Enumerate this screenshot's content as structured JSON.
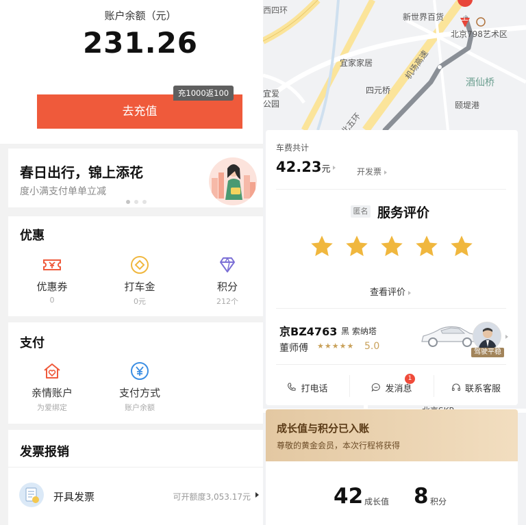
{
  "wallet": {
    "balance_label": "账户余额（元）",
    "balance": "231.26",
    "recharge_label": "去充值",
    "promo_tag": "充1000返100"
  },
  "banner": {
    "title": "春日出行，锦上添花",
    "subtitle": "度小满支付单单立减",
    "carousel_pages": 3,
    "carousel_active": 1
  },
  "discounts": {
    "title": "优惠",
    "items": [
      {
        "label": "优惠券",
        "sub": "0",
        "icon": "ticket-icon"
      },
      {
        "label": "打车金",
        "sub": "0元",
        "icon": "coin-icon"
      },
      {
        "label": "积分",
        "sub": "212个",
        "icon": "diamond-icon"
      }
    ]
  },
  "payment": {
    "title": "支付",
    "items": [
      {
        "label": "亲情账户",
        "sub": "为爱绑定",
        "icon": "family-house-icon"
      },
      {
        "label": "支付方式",
        "sub": "账户余额",
        "icon": "yen-icon"
      }
    ]
  },
  "invoice": {
    "title": "发票报销",
    "row_label": "开具发票",
    "quota": "可开额度3,053.17元"
  },
  "map": {
    "labels": [
      "西四环",
      "新世界百货",
      "北京798艺术区",
      "宜家家居",
      "机场高速",
      "酒仙桥",
      "四元桥",
      "颐堤港",
      "宜爱",
      "公园",
      "北五环",
      "北京SKP",
      "上"
    ]
  },
  "trip": {
    "fare_label": "车费共计",
    "fare": "42.23",
    "fare_unit": "元",
    "invoice_link": "开发票",
    "anon_tag": "匿名",
    "rating_title": "服务评价",
    "stars": 5,
    "view_rating": "查看评价",
    "plate": "京BZ4763",
    "car_desc": "黑  索纳塔",
    "driver_name": "董师傅",
    "driver_stars": "★★★★★",
    "driver_score": "5.0",
    "driver_badge": "驾驶平稳",
    "actions": [
      {
        "label": "打电话",
        "icon": "phone-icon"
      },
      {
        "label": "发消息",
        "icon": "message-icon",
        "badge": "1"
      },
      {
        "label": "联系客服",
        "icon": "headset-icon"
      }
    ]
  },
  "growth": {
    "title": "成长值与积分已入账",
    "subtitle": "尊敬的黄金会员，本次行程将获得",
    "growth_value": "42",
    "growth_unit": "成长值",
    "points_value": "8",
    "points_unit": "积分"
  },
  "colors": {
    "accent": "#ef5a3b",
    "star": "#f0b73e",
    "gold": "#c9a15a",
    "growth_text": "#5a3a16"
  }
}
